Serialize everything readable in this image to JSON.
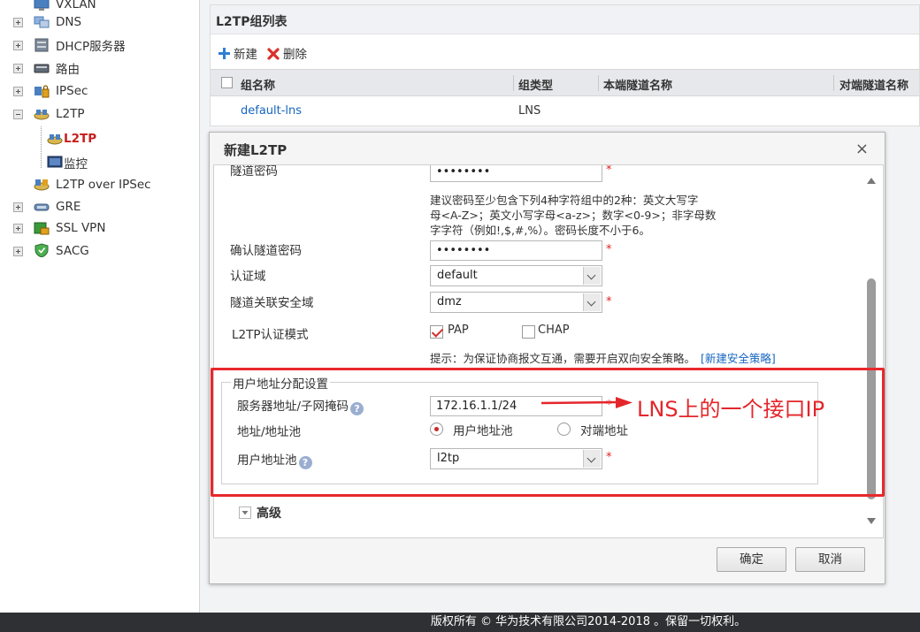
{
  "sidebar": {
    "items": [
      {
        "label": "VXLAN",
        "expander": "none",
        "icon": "monitor-icon"
      },
      {
        "label": "DNS",
        "expander": "plus",
        "icon": "dns-icon"
      },
      {
        "label": "DHCP服务器",
        "expander": "plus",
        "icon": "server-icon"
      },
      {
        "label": "路由",
        "expander": "plus",
        "icon": "router-icon"
      },
      {
        "label": "IPSec",
        "expander": "plus",
        "icon": "ipsec-icon"
      },
      {
        "label": "L2TP",
        "expander": "minus",
        "icon": "l2tp-icon"
      },
      {
        "label": "L2TP",
        "child": true,
        "active": true,
        "icon": "l2tp-icon"
      },
      {
        "label": "监控",
        "child": true,
        "icon": "monitor-icon"
      },
      {
        "label": "L2TP over IPSec",
        "expander": "none",
        "icon": "l2tp-ipsec-icon"
      },
      {
        "label": "GRE",
        "expander": "plus",
        "icon": "gre-icon"
      },
      {
        "label": "SSL VPN",
        "expander": "plus",
        "icon": "ssl-vpn-icon"
      },
      {
        "label": "SACG",
        "expander": "plus",
        "icon": "shield-icon"
      }
    ]
  },
  "group_list": {
    "title": "L2TP组列表",
    "toolbar": {
      "new_label": "新建",
      "delete_label": "删除"
    },
    "columns": [
      "组名称",
      "组类型",
      "本端隧道名称",
      "对端隧道名称"
    ],
    "rows": [
      {
        "name": "default-lns",
        "type": "LNS",
        "local_tunnel": "",
        "peer_tunnel": ""
      }
    ]
  },
  "dialog": {
    "title": "新建L2TP",
    "close_glyph": "×",
    "tunnel_password_label": "隧道密码",
    "tunnel_password_value": "••••••••",
    "password_hint": [
      "建议密码至少包含下列4种字符组中的2种：英文大写字",
      "母<A-Z>；英文小写字母<a-z>；数字<0-9>；非字母数",
      "字字符（例如!,$,#,%）。密码长度不小于6。"
    ],
    "confirm_password_label": "确认隧道密码",
    "confirm_password_value": "••••••••",
    "auth_domain_label": "认证域",
    "auth_domain_value": "default",
    "zone_label": "隧道关联安全域",
    "zone_value": "dmz",
    "auth_mode_label": "L2TP认证模式",
    "auth_pap_label": "PAP",
    "auth_pap_checked": true,
    "auth_chap_label": "CHAP",
    "auth_chap_checked": false,
    "policy_hint": "提示：为保证协商报文互通，需要开启双向安全策略。",
    "policy_link": "[新建安全策略]",
    "address_section": {
      "legend": "用户地址分配设置",
      "server_label": "服务器地址/子网掩码",
      "server_value": "172.16.1.1/24",
      "pool_type_label": "地址/地址池",
      "pool_option_user": "用户地址池",
      "pool_option_peer": "对端地址",
      "pool_selected": "user",
      "user_pool_label": "用户地址池",
      "user_pool_value": "l2tp"
    },
    "advanced_label": "高级",
    "ok_label": "确定",
    "cancel_label": "取消",
    "required_mark": "*"
  },
  "annotation": {
    "text": "LNS上的一个接口IP",
    "color": "#e4262b"
  },
  "footer": {
    "text": "版权所有 © 华为技术有限公司2014-2018 。保留一切权利。"
  },
  "colors": {
    "accent_red": "#e8282c",
    "link_blue": "#1565c0",
    "active_nav": "#c81d1d"
  }
}
